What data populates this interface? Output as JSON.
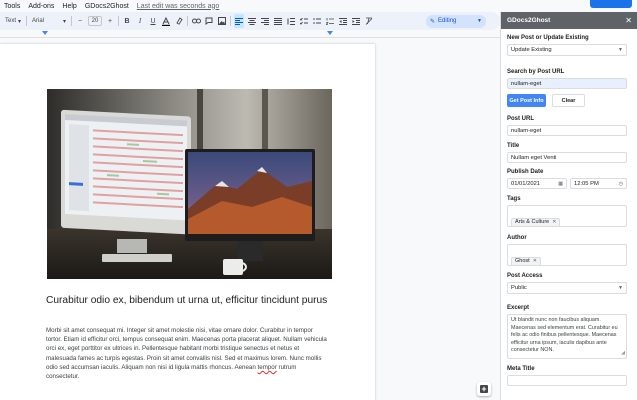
{
  "menubar": {
    "items": [
      "Tools",
      "Add-ons",
      "Help",
      "GDocs2Ghost"
    ],
    "last_edit": "Last edit was seconds ago"
  },
  "toolbar": {
    "style": "Text",
    "font": "Arial",
    "size_minus": "−",
    "font_size": "20",
    "size_plus": "+",
    "bold": "B",
    "italic": "I",
    "underline": "U",
    "editing_label": "Editing"
  },
  "document": {
    "title": "Curabitur odio ex, bibendum ut urna ut, efficitur tincidunt purus",
    "body_before": "Morbi sit amet consequat mi. Integer sit amet molestie nisi, vitae ornare dolor. Curabitur in tempor tortor. Etiam id efficitur orci, tempus consequat enim. Maecenas porta placerat aliquet. Nullam vehicula orci ex, eget porttitor ex ultrices in. Pellentesque habitant morbi tristique senectus et netus et malesuada fames ac turpis egestas. Proin sit amet convallis nisl. Sed et maximus lorem. Nunc mollis odio sed accumsan iaculis. Aliquam non nisi id ligula mattis rhoncus. Aenean ",
    "body_error": "tempor",
    "body_after": " rutrum consectetur."
  },
  "sidebar": {
    "header": "GDocs2Ghost",
    "close": "✕",
    "mode_label": "New Post or Update Existing",
    "mode_value": "Update Existing",
    "search_label": "Search by Post URL",
    "search_value": "nullam-eget",
    "get_post_info": "Get Post Info",
    "clear": "Clear",
    "post_url_label": "Post URL",
    "post_url_value": "nullam-eget",
    "title_label": "Title",
    "title_value": "Nullam eget Venti",
    "publish_date_label": "Publish Date",
    "publish_date_value": "01/01/2021",
    "publish_time_value": "12:05 PM",
    "tags_label": "Tags",
    "tag_chip": "Arts & Culture",
    "author_label": "Author",
    "author_chip": "Ghost",
    "access_label": "Post Access",
    "access_value": "Public",
    "excerpt_label": "Excerpt",
    "excerpt_value": "Ut blandit nunc non faucibus aliquam. Maecenas sed elementum erat. Curabitur eu felis ac odio finibus pellentesque. Maecenas efficitur urna ipsum, iaculis dapibus ante consectetur NON.",
    "meta_title_label": "Meta Title"
  },
  "colors": {
    "accent": "#1a73e8",
    "sidebar_header": "#5f6368",
    "toolbar_bg": "#edf2fa"
  }
}
